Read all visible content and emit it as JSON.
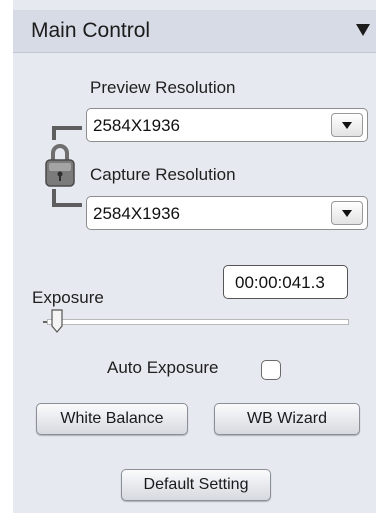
{
  "panel": {
    "title": "Main Control",
    "collapse_icon": "triangle-down-icon"
  },
  "preview": {
    "label": "Preview Resolution",
    "value": "2584X1936"
  },
  "capture": {
    "label": "Capture Resolution",
    "value": "2584X1936"
  },
  "lock": {
    "icon": "padlock-icon",
    "locked": true
  },
  "exposure": {
    "label": "Exposure",
    "time_value": "00:00:041.3",
    "slider_level": 0.02,
    "auto_label": "Auto Exposure",
    "auto_checked": false
  },
  "buttons": {
    "white_balance": "White Balance",
    "wb_wizard": "WB Wizard",
    "default_setting": "Default Setting"
  },
  "colors": {
    "panel_bg": "#e6e9ef",
    "header_bg": "#d7dbe5"
  }
}
